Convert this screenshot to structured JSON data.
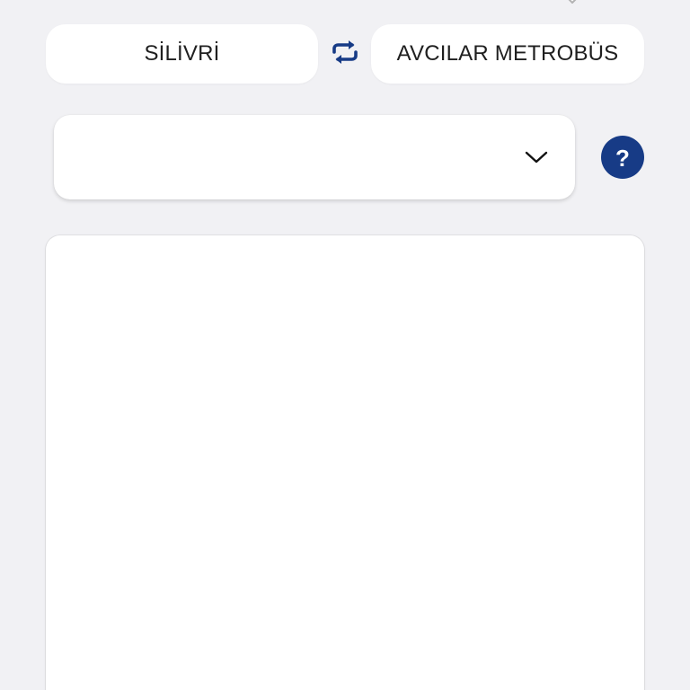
{
  "route": {
    "from_stop": "SİLİVRİ",
    "to_stop": "AVCILAR METROBÜS"
  },
  "selector": {
    "selected_value": ""
  },
  "help": {
    "mark": "?"
  },
  "icons": {
    "swap": "swap-arrows-icon",
    "dropdown": "chevron-down-icon",
    "top": "chevron-down-icon",
    "help": "question-mark-icon"
  },
  "colors": {
    "accent": "#173b86",
    "background": "#f1f1f4",
    "card": "#ffffff"
  }
}
